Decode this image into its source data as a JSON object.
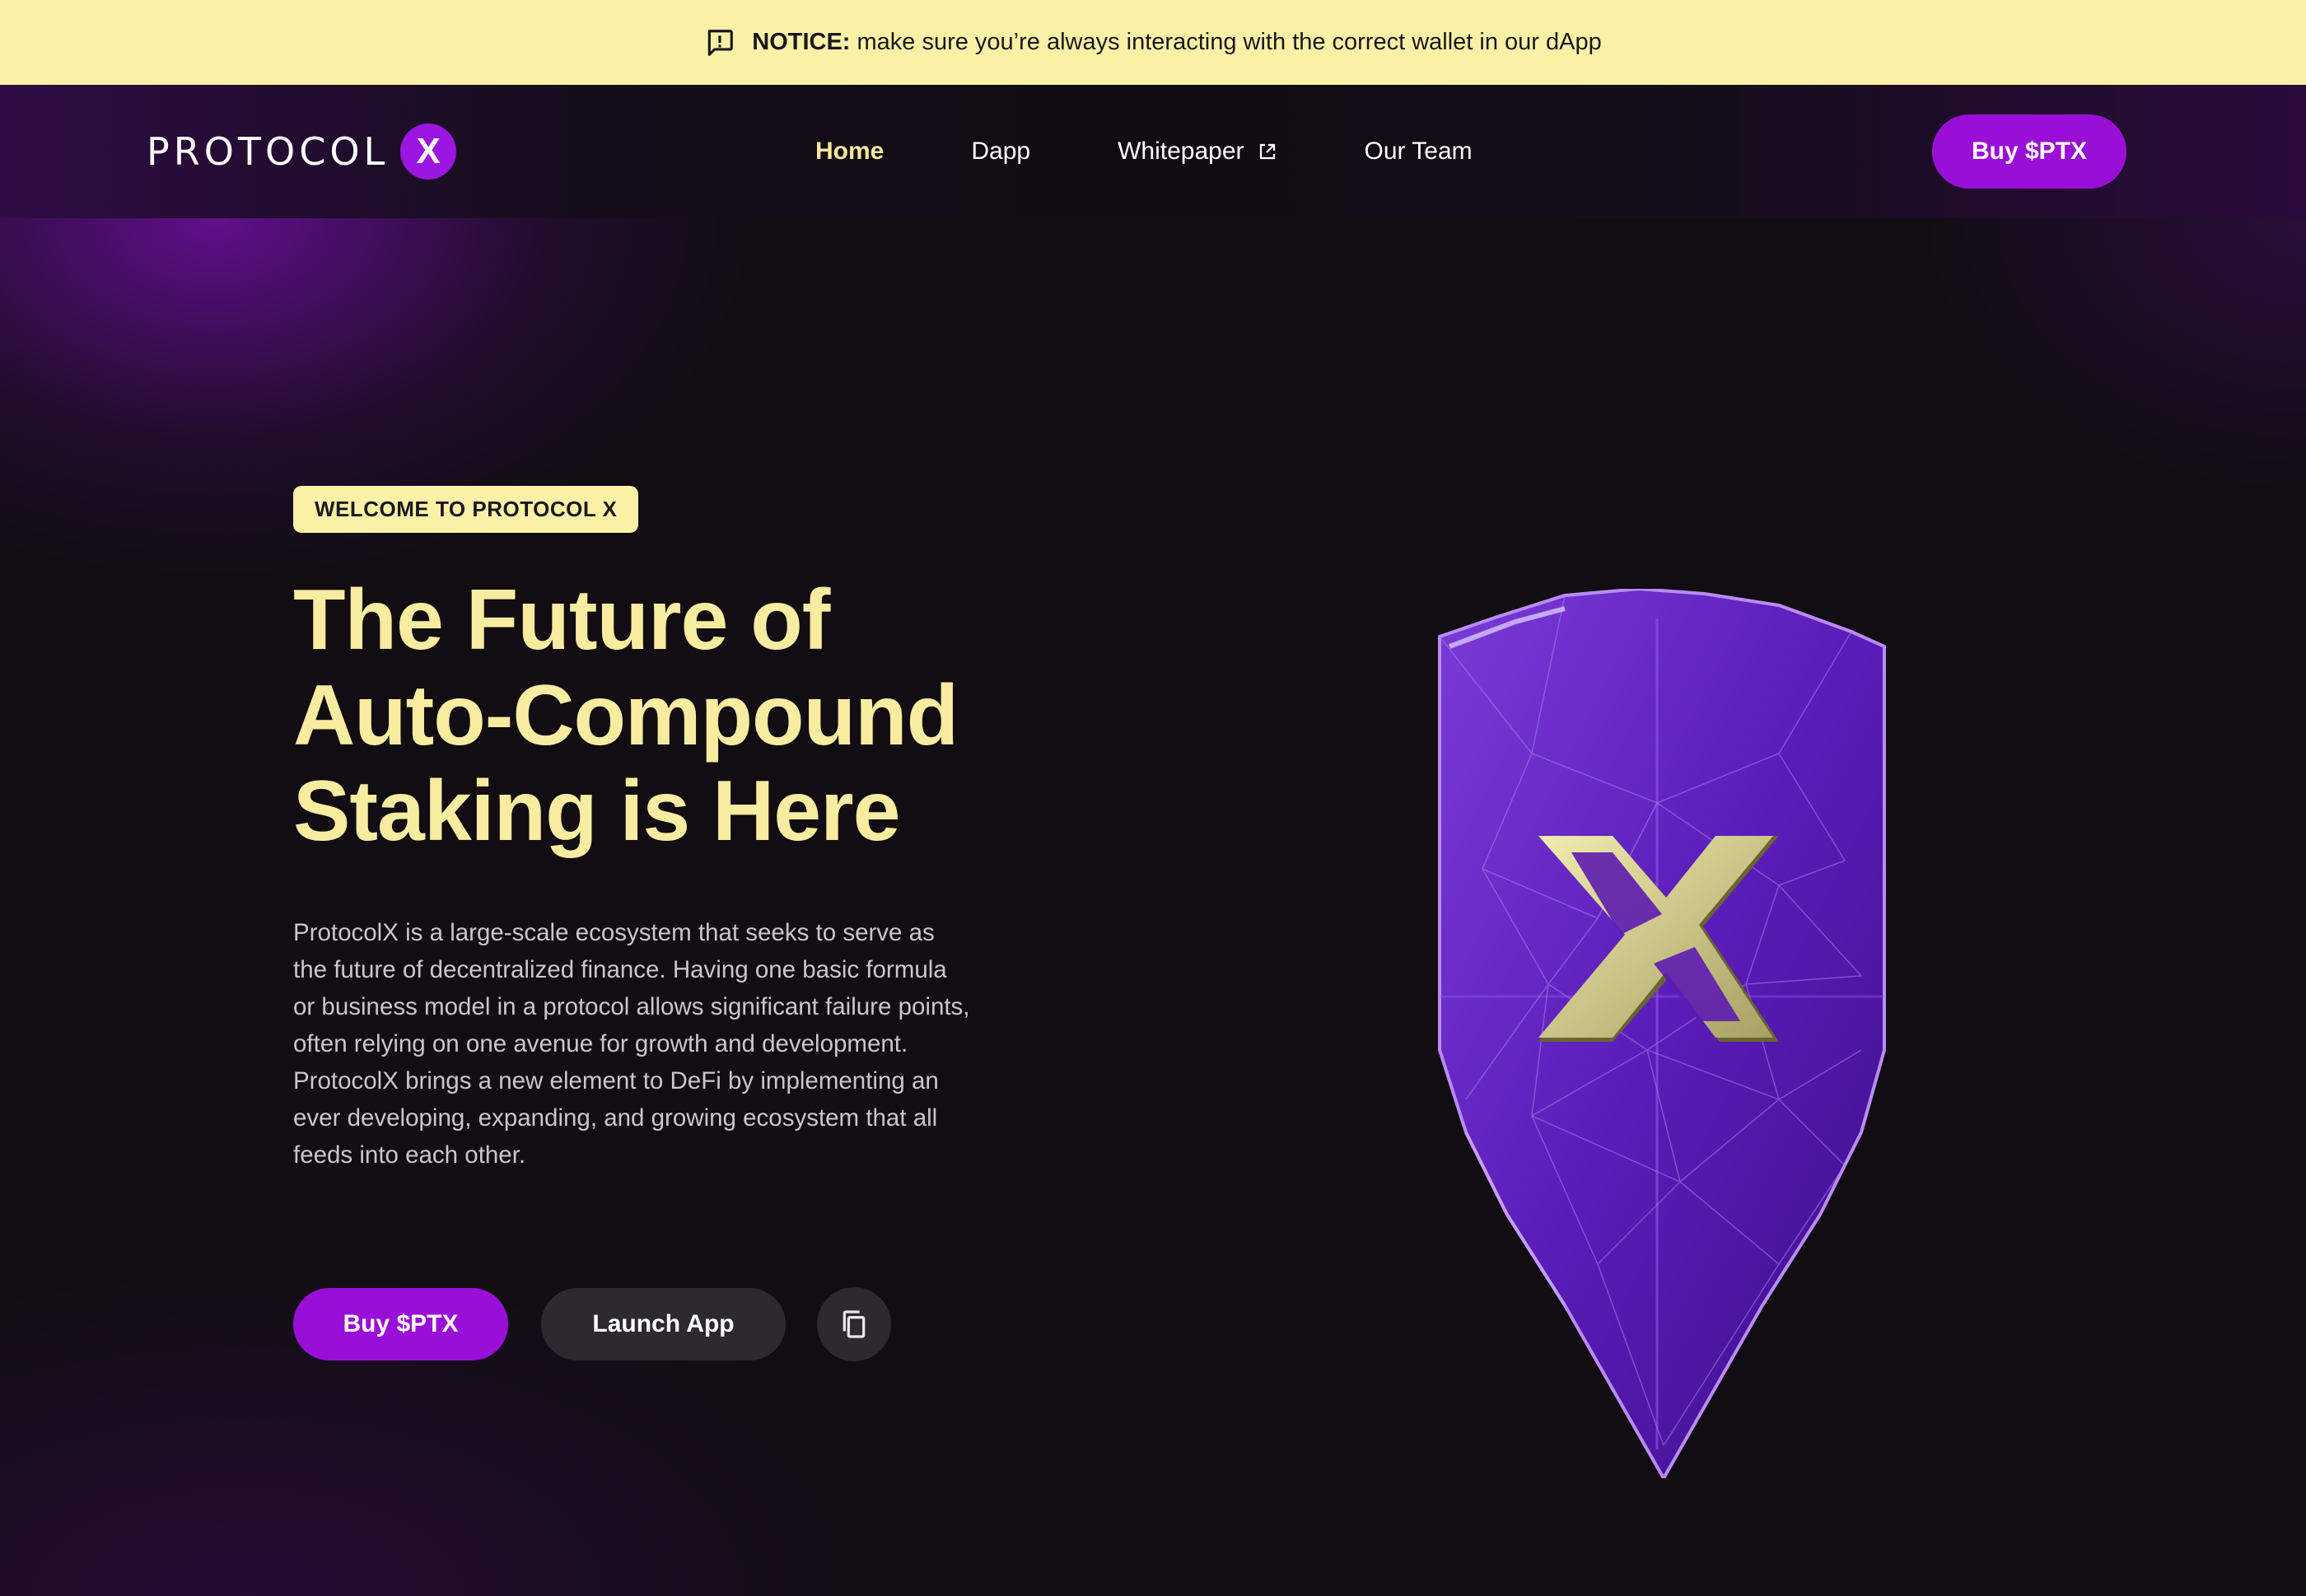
{
  "notice": {
    "label": "NOTICE:",
    "text": "make sure you’re always interacting with the correct wallet in our dApp"
  },
  "nav": {
    "logo_text": "PROTOCOL",
    "logo_badge": "X",
    "items": [
      {
        "label": "Home",
        "active": true
      },
      {
        "label": "Dapp"
      },
      {
        "label": "Whitepaper",
        "external": true
      },
      {
        "label": "Our Team"
      }
    ],
    "buy_label": "Buy $PTX"
  },
  "hero": {
    "pill": "WELCOME TO PROTOCOL X",
    "headline": [
      "The Future of",
      "Auto-Compound",
      "Staking is Here"
    ],
    "description": [
      "ProtocolX is a large-scale ecosystem that seeks to serve as",
      "the future of decentralized finance. Having one basic formula",
      "or business model in a protocol allows significant failure points,",
      "often relying on one avenue for growth and development.",
      "ProtocolX brings a new element to DeFi by implementing an",
      "ever developing, expanding, and growing ecosystem that all",
      "feeds into each other."
    ],
    "buy_label": "Buy $PTX",
    "launch_label": "Launch App"
  },
  "colors": {
    "notice_bg": "#fbf1a6",
    "accent_purple": "#9a0fd8",
    "headline_yellow": "#f7ec9f",
    "background": "#110d12"
  },
  "icons": [
    "notice-icon",
    "external-link-icon",
    "copy-icon",
    "shield-x-illustration"
  ]
}
